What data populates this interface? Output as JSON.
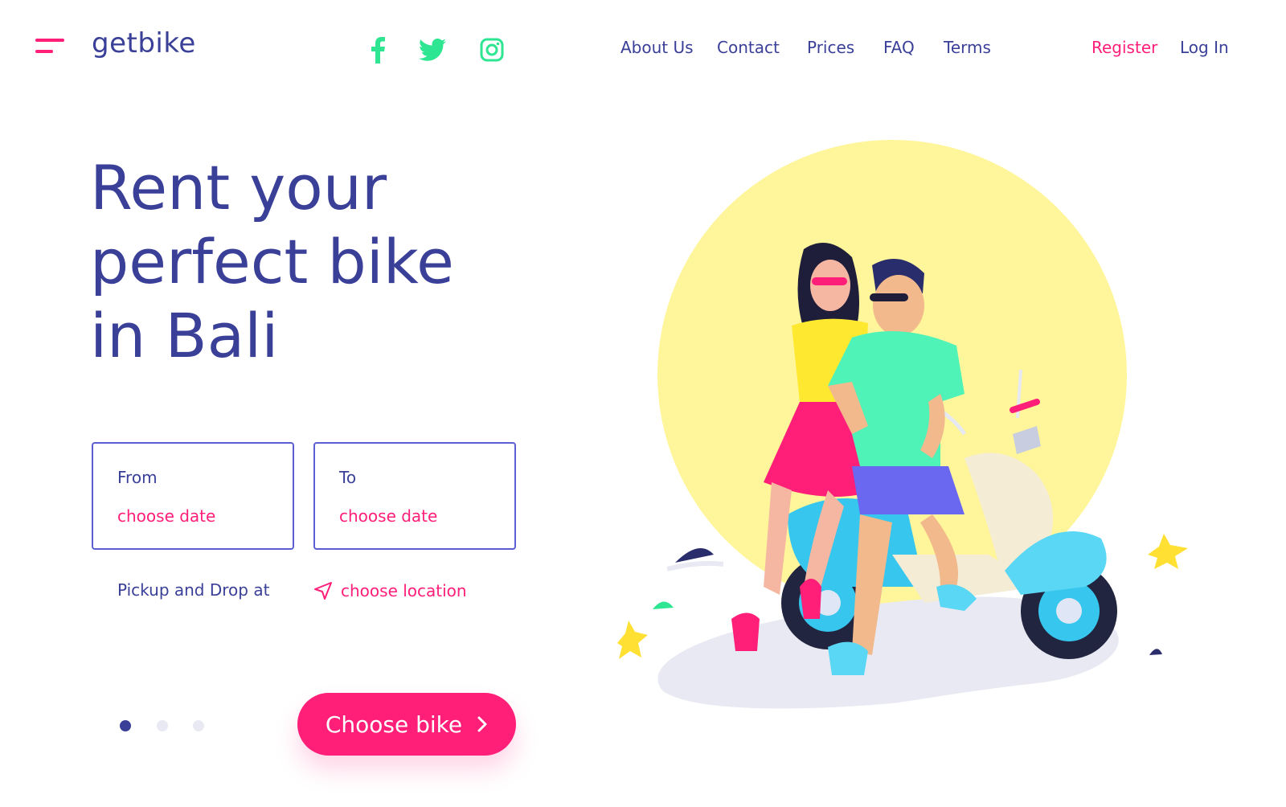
{
  "header": {
    "brand": "getbike",
    "menu_icon": "hamburger-menu-icon",
    "social": [
      {
        "icon": "facebook-icon"
      },
      {
        "icon": "twitter-icon"
      },
      {
        "icon": "instagram-icon"
      }
    ],
    "nav": {
      "about": "About Us",
      "contact": "Contact",
      "prices": "Prices",
      "faq": "FAQ",
      "terms": "Terms"
    },
    "register": "Register",
    "login": "Log In"
  },
  "hero": {
    "title_line1": "Rent your",
    "title_line2": "perfect bike",
    "title_line3": "in Bali"
  },
  "booking": {
    "from_label": "From",
    "from_value": "choose date",
    "to_label": "To",
    "to_value": "choose date",
    "pickup_label": "Pickup and Drop at",
    "location_value": "choose location",
    "location_icon": "navigation-arrow-icon"
  },
  "carousel": {
    "count": 3,
    "active_index": 0
  },
  "cta": {
    "label": "Choose bike",
    "icon": "chevron-right-icon"
  },
  "colors": {
    "primary": "#3a3f98",
    "accent": "#ff1e78",
    "social": "#2ee592",
    "sun": "#fff59a",
    "shadow": "#e9e9f3"
  }
}
